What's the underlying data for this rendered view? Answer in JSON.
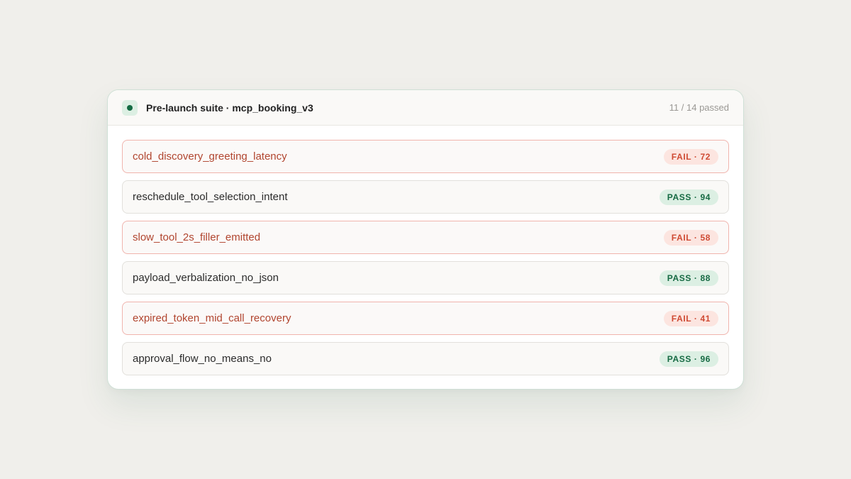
{
  "header": {
    "title": "Pre-launch suite · mcp_booking_v3",
    "summary": "11 / 14 passed",
    "status_icon": "status-dot-icon"
  },
  "colors": {
    "pass_text": "#166a43",
    "pass_bg": "#dcefe3",
    "fail_text": "#cf4a33",
    "fail_bg": "#fce5e0",
    "fail_border": "#f0b4ad"
  },
  "tests": [
    {
      "name": "cold_discovery_greeting_latency",
      "status": "fail",
      "badge": "FAIL · 72"
    },
    {
      "name": "reschedule_tool_selection_intent",
      "status": "pass",
      "badge": "PASS · 94"
    },
    {
      "name": "slow_tool_2s_filler_emitted",
      "status": "fail",
      "badge": "FAIL · 58"
    },
    {
      "name": "payload_verbalization_no_json",
      "status": "pass",
      "badge": "PASS · 88"
    },
    {
      "name": "expired_token_mid_call_recovery",
      "status": "fail",
      "badge": "FAIL · 41"
    },
    {
      "name": "approval_flow_no_means_no",
      "status": "pass",
      "badge": "PASS · 96"
    }
  ]
}
